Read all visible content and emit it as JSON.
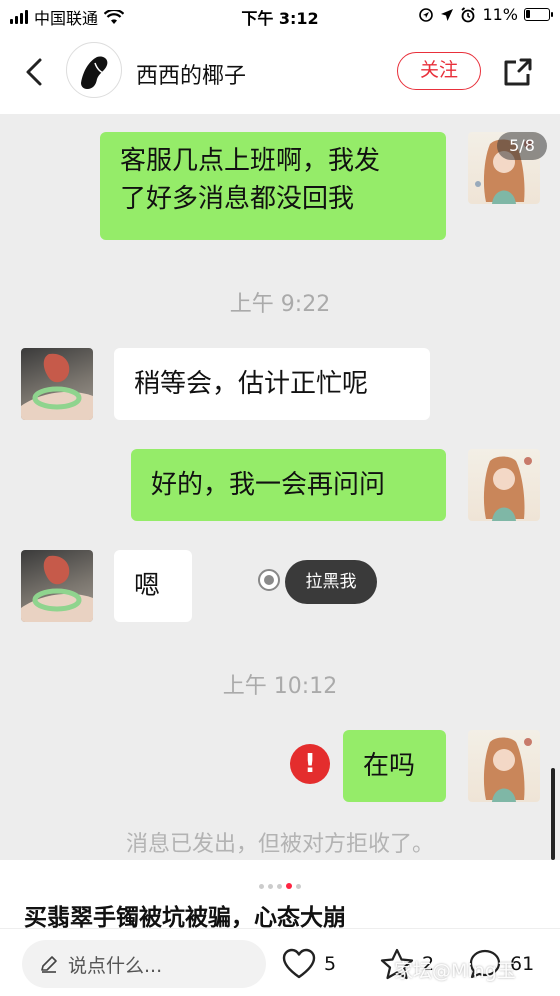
{
  "status_bar": {
    "carrier": "中国联通",
    "time": "下午 3:12",
    "battery": "11%"
  },
  "header": {
    "nickname": "西西的椰子",
    "follow_label": "关注"
  },
  "chat": {
    "page_indicator": "5/8",
    "messages": [
      {
        "from": "me",
        "line1": "客服几点上班啊，我发",
        "line2": "了好多消息都没回我"
      },
      {
        "from": "other",
        "text": "稍等会，估计正忙呢"
      },
      {
        "from": "me",
        "text": "好的，我一会再问问"
      },
      {
        "from": "other",
        "text": "嗯"
      },
      {
        "from": "me",
        "text": "在吗"
      }
    ],
    "time_1": "上午 9:22",
    "time_2": "上午 10:12",
    "block_label": "拉黑我",
    "error_mark": "!",
    "system_message": "消息已发出，但被对方拒收了。"
  },
  "post": {
    "title": "买翡翠手镯被坑被骗，心态大崩"
  },
  "bottom_bar": {
    "comment_placeholder": "说点什么...",
    "likes": "5",
    "collects": "2",
    "comments": "61",
    "watermark": "家坛@Ming玉"
  }
}
